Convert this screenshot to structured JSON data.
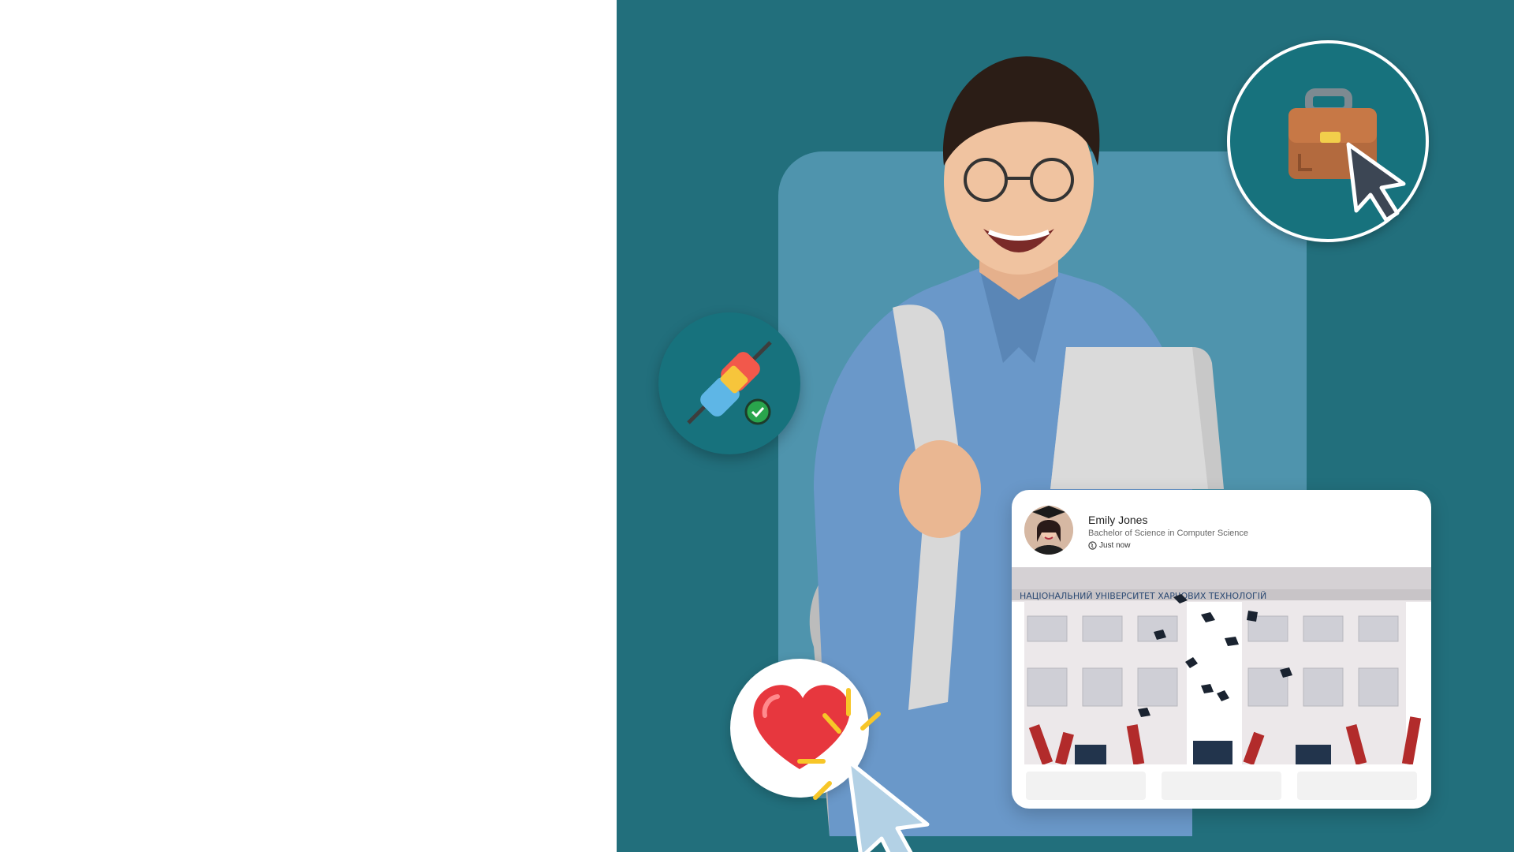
{
  "post": {
    "author": "Emily Jones",
    "subtitle": "Bachelor of Science in Computer Science",
    "time": "Just now",
    "image_banner_text": "НАЦІОНАЛЬНИЙ УНІВЕРСИТЕТ ХАРЧОВИХ ТЕХНОЛОГІЙ"
  },
  "icons": {
    "briefcase": "briefcase-icon",
    "plug": "plug-icon",
    "heart": "heart-icon",
    "cursor": "cursor-icon",
    "globe": "globe-icon"
  },
  "colors": {
    "hero_bg": "#226f7c",
    "backdrop": "#4f94ad",
    "circle": "#17727d"
  }
}
